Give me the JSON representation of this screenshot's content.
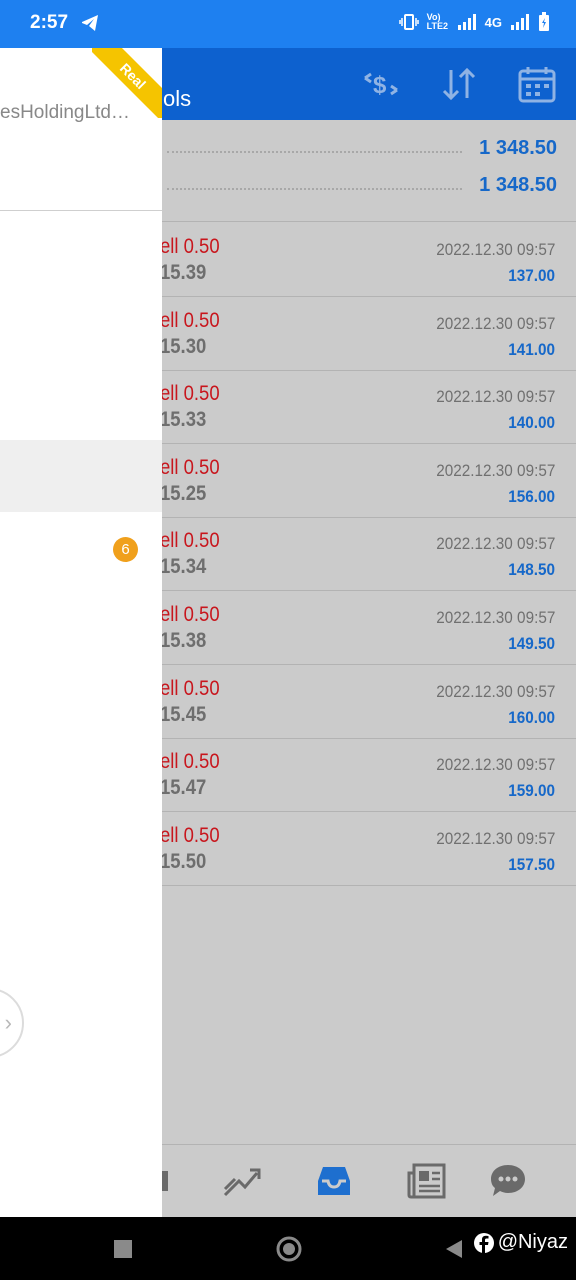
{
  "status_bar": {
    "time": "2:57",
    "network": "4G",
    "volte_label": "Vo) LTE2"
  },
  "header": {
    "title_fragment": "ols"
  },
  "summary": [
    {
      "value": "1 348.50"
    },
    {
      "value": "1 348.50"
    }
  ],
  "trades": [
    {
      "type": "ell 0.50",
      "price": "15.39",
      "time": "2022.12.30 09:57",
      "profit": "137.00"
    },
    {
      "type": "ell 0.50",
      "price": "15.30",
      "time": "2022.12.30 09:57",
      "profit": "141.00"
    },
    {
      "type": "ell 0.50",
      "price": "15.33",
      "time": "2022.12.30 09:57",
      "profit": "140.00"
    },
    {
      "type": "ell 0.50",
      "price": "15.25",
      "time": "2022.12.30 09:57",
      "profit": "156.00"
    },
    {
      "type": "ell 0.50",
      "price": "15.34",
      "time": "2022.12.30 09:57",
      "profit": "148.50"
    },
    {
      "type": "ell 0.50",
      "price": "15.38",
      "time": "2022.12.30 09:57",
      "profit": "149.50"
    },
    {
      "type": "ell 0.50",
      "price": "15.45",
      "time": "2022.12.30 09:57",
      "profit": "160.00"
    },
    {
      "type": "ell 0.50",
      "price": "15.47",
      "time": "2022.12.30 09:57",
      "profit": "159.00"
    },
    {
      "type": "ell 0.50",
      "price": "15.50",
      "time": "2022.12.30 09:57",
      "profit": "157.50"
    }
  ],
  "drawer": {
    "account_name": "esHoldingLtd…",
    "ribbon": "Real",
    "badge_count": "6"
  },
  "watermark": "@Niyaz",
  "colors": {
    "status_bar": "#1e80f0",
    "header": "#0d61cf",
    "sell": "#c8161d",
    "profit": "#1668c9",
    "badge": "#f0a01c",
    "ribbon": "#f5c400"
  }
}
